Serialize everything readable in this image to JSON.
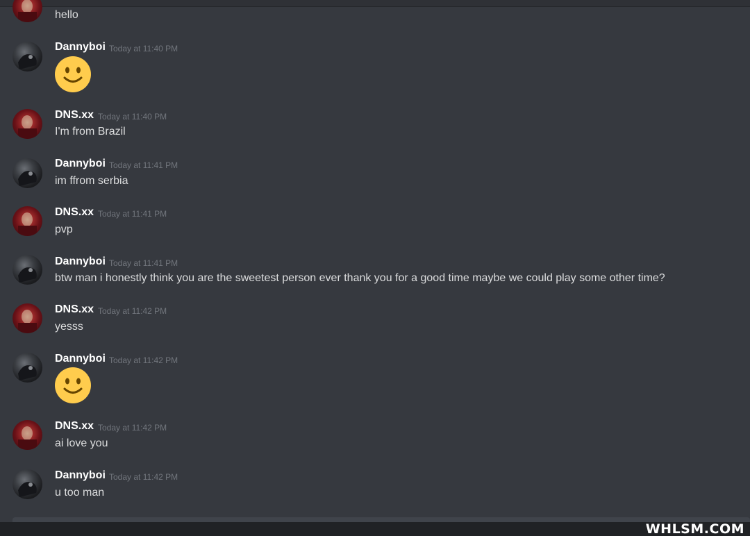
{
  "messages": [
    {
      "author": "",
      "time": "",
      "text": "hello",
      "avatar": "red",
      "emoji": false
    },
    {
      "author": "Dannyboi",
      "time": "Today at 11:40 PM",
      "text": "",
      "avatar": "dark",
      "emoji": true
    },
    {
      "author": "DNS.xx",
      "time": "Today at 11:40 PM",
      "text": "I'm from Brazil",
      "avatar": "red",
      "emoji": false
    },
    {
      "author": "Dannyboi",
      "time": "Today at 11:41 PM",
      "text": "im ffrom serbia",
      "avatar": "dark",
      "emoji": false
    },
    {
      "author": "DNS.xx",
      "time": "Today at 11:41 PM",
      "text": "pvp",
      "avatar": "red",
      "emoji": false
    },
    {
      "author": "Dannyboi",
      "time": "Today at 11:41 PM",
      "text": "btw man i honestly think you are the sweetest person ever thank you for a good time maybe we could play some other time?",
      "avatar": "dark",
      "emoji": false
    },
    {
      "author": "DNS.xx",
      "time": "Today at 11:42 PM",
      "text": "yesss",
      "avatar": "red",
      "emoji": false
    },
    {
      "author": "Dannyboi",
      "time": "Today at 11:42 PM",
      "text": "",
      "avatar": "dark",
      "emoji": true
    },
    {
      "author": "DNS.xx",
      "time": "Today at 11:42 PM",
      "text": "ai love you",
      "avatar": "red",
      "emoji": false
    },
    {
      "author": "Dannyboi",
      "time": "Today at 11:42 PM",
      "text": "u too man",
      "avatar": "dark",
      "emoji": false
    }
  ],
  "emoji_icon": "slightly-smiling-face-icon",
  "watermark": "WHLSM.COM",
  "colors": {
    "background": "#36393f",
    "author": "#ffffff",
    "timestamp": "#72767d",
    "message": "#dcddde",
    "emoji": "#ffcc4d"
  }
}
